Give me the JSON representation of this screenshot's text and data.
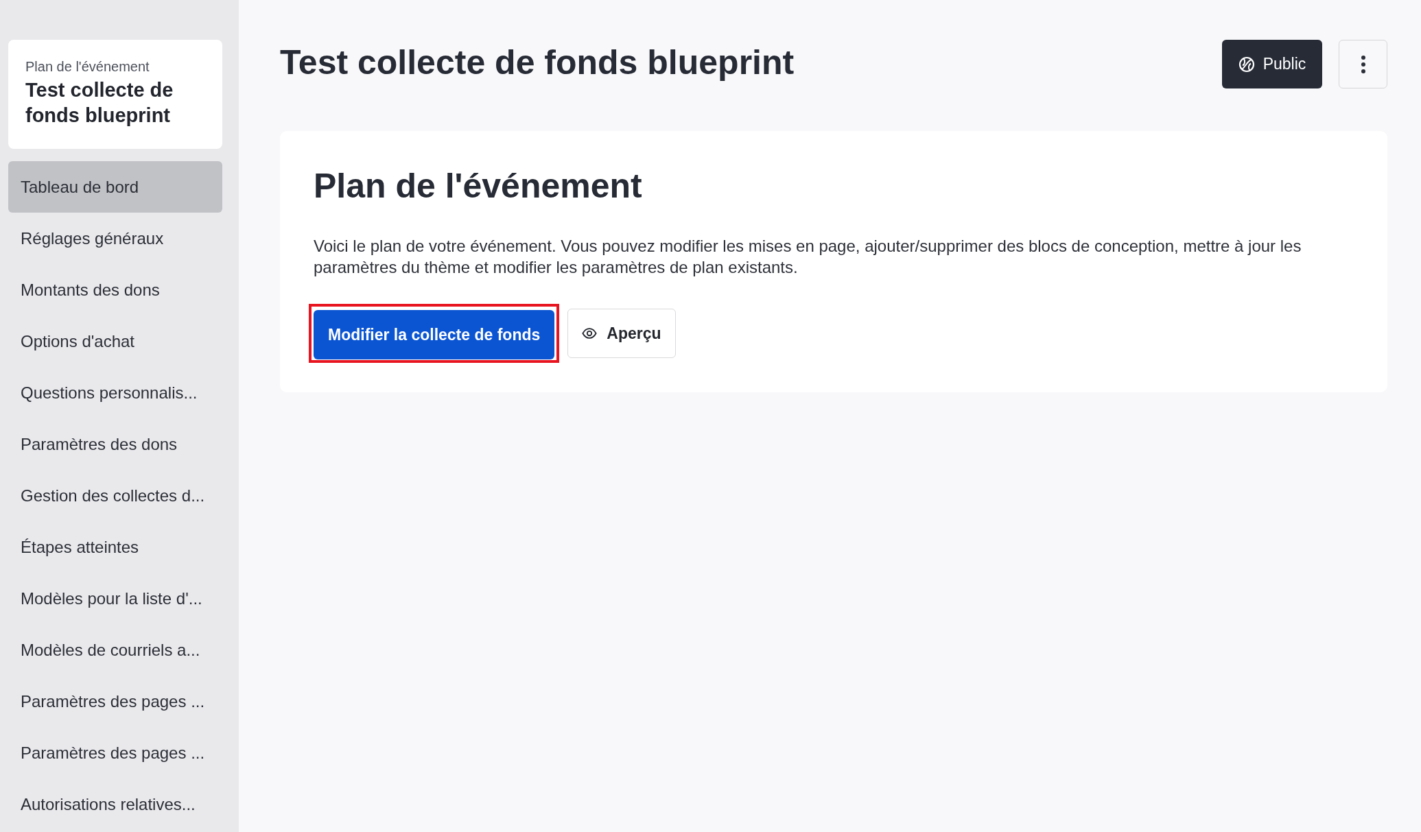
{
  "sidebar": {
    "event_card": {
      "subtitle": "Plan de l'événement",
      "title": "Test collecte de fonds blueprint"
    },
    "items": [
      {
        "label": "Tableau de bord",
        "selected": true
      },
      {
        "label": "Réglages généraux",
        "selected": false
      },
      {
        "label": "Montants des dons",
        "selected": false
      },
      {
        "label": "Options d'achat",
        "selected": false
      },
      {
        "label": "Questions personnalis...",
        "selected": false
      },
      {
        "label": "Paramètres des dons",
        "selected": false
      },
      {
        "label": "Gestion des collectes d...",
        "selected": false
      },
      {
        "label": "Étapes atteintes",
        "selected": false
      },
      {
        "label": "Modèles pour la liste d'...",
        "selected": false
      },
      {
        "label": "Modèles de courriels a...",
        "selected": false
      },
      {
        "label": "Paramètres des pages ...",
        "selected": false
      },
      {
        "label": "Paramètres des pages ...",
        "selected": false
      },
      {
        "label": "Autorisations relatives...",
        "selected": false
      }
    ]
  },
  "header": {
    "title": "Test collecte de fonds blueprint",
    "visibility_button": {
      "label": "Public"
    }
  },
  "card": {
    "heading": "Plan de l'événement",
    "description": "Voici le plan de votre événement. Vous pouvez modifier les mises en page, ajouter/supprimer des blocs de conception, mettre à jour les paramètres du thème et modifier les paramètres de plan existants.",
    "buttons": [
      {
        "label": "Modifier la collecte de fonds",
        "kind": "primary",
        "highlighted": true
      },
      {
        "label": "Aperçu",
        "kind": "secondary",
        "highlighted": false
      }
    ]
  }
}
